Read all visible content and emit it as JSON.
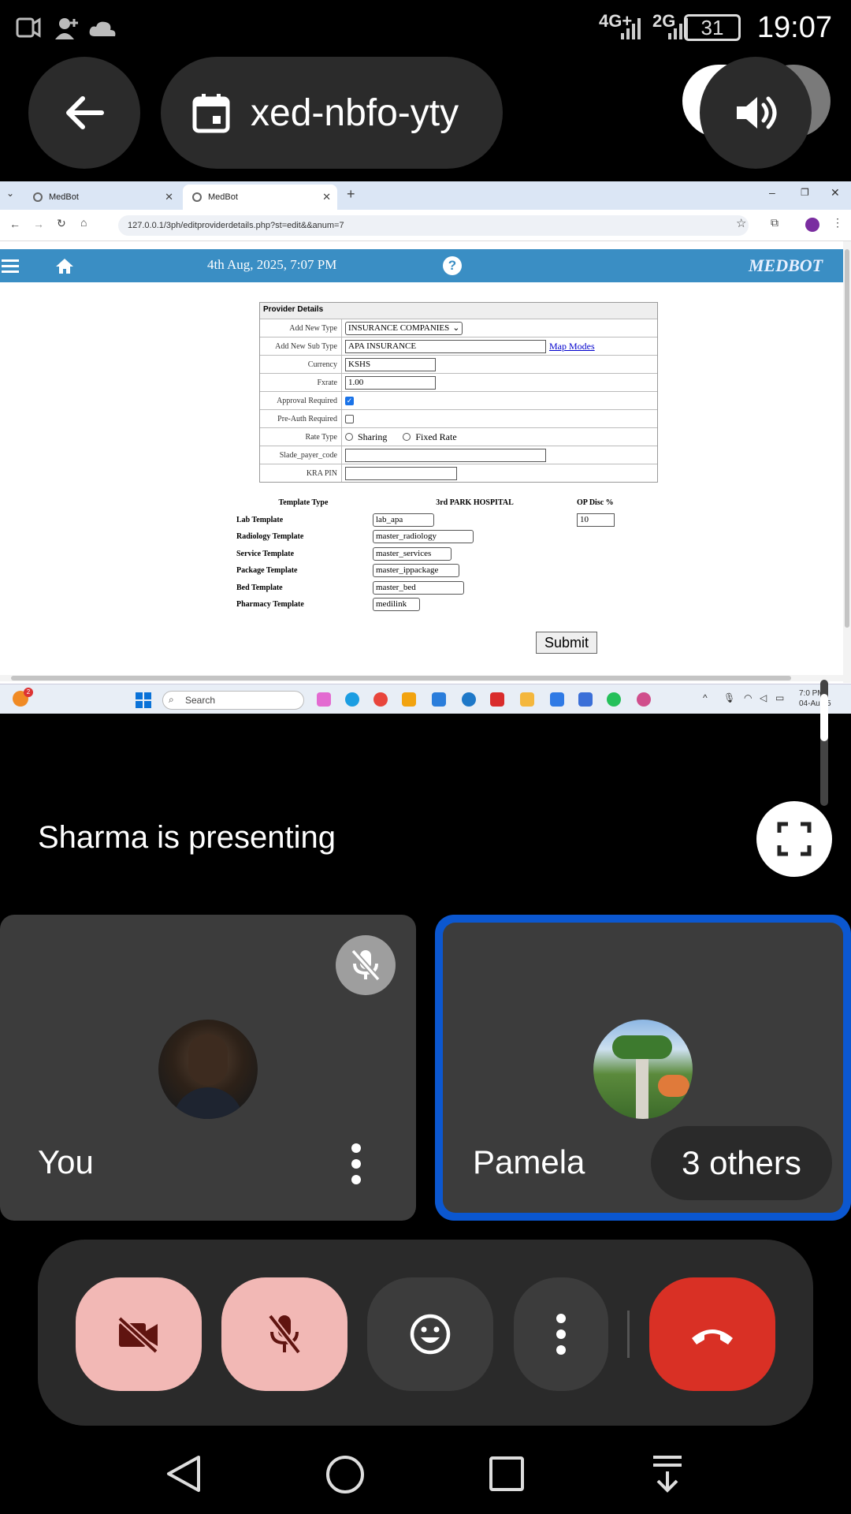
{
  "status_bar": {
    "time": "19:07",
    "battery": "31",
    "network_1": "4G+",
    "network_2": "2G"
  },
  "meeting": {
    "code": "xed-nbfo-yty",
    "presenting_text": "Sharma is presenting"
  },
  "browser": {
    "tabs": [
      {
        "label": "MedBot"
      },
      {
        "label": "MedBot"
      }
    ],
    "url": "127.0.0.1/3ph/editproviderdetails.php?st=edit&&anum=7"
  },
  "medbot": {
    "date": "4th Aug, 2025, 7:07 PM",
    "logo": "MEDBOT",
    "provider_details": {
      "title": "Provider Details",
      "rows": {
        "add_new_type_label": "Add New Type",
        "add_new_type_value": "INSURANCE COMPANIES",
        "add_new_sub_type_label": "Add New Sub Type",
        "add_new_sub_type_value": "APA INSURANCE",
        "map_modes_link": "Map Modes",
        "currency_label": "Currency",
        "currency_value": "KSHS",
        "fxrate_label": "Fxrate",
        "fxrate_value": "1.00",
        "approval_label": "Approval Required",
        "preauth_label": "Pre-Auth Required",
        "rate_type_label": "Rate Type",
        "rate_sharing": "Sharing",
        "rate_fixed": "Fixed Rate",
        "slade_label": "Slade_payer_code",
        "kra_label": "KRA PIN"
      }
    },
    "templates": {
      "header_type": "Template Type",
      "header_hospital": "3rd PARK HOSPITAL",
      "header_disc": "OP Disc %",
      "op_disc_value": "10",
      "rows": [
        {
          "label": "Lab Template",
          "value": "lab_apa"
        },
        {
          "label": "Radiology Template",
          "value": "master_radiology"
        },
        {
          "label": "Service Template",
          "value": "master_services"
        },
        {
          "label": "Package Template",
          "value": "master_ippackage"
        },
        {
          "label": "Bed Template",
          "value": "master_bed"
        },
        {
          "label": "Pharmacy Template",
          "value": "medilink"
        }
      ]
    },
    "submit_label": "Submit"
  },
  "taskbar": {
    "search_placeholder": "Search",
    "clock_time": "7:0 PM",
    "clock_date": "04-Au 25",
    "badge_count": "2"
  },
  "participants": {
    "you_label": "You",
    "pamela_label": "Pamela",
    "others_label": "3 others"
  }
}
